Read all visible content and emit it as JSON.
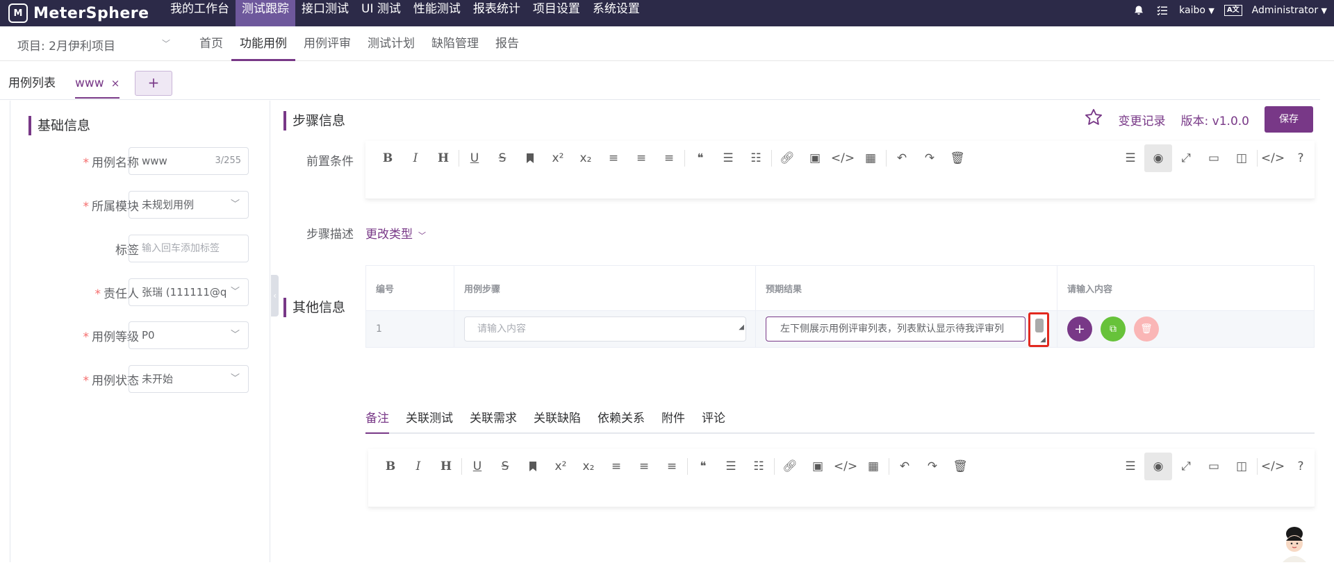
{
  "app": {
    "logo_text": "MeterSphere"
  },
  "topnav": [
    {
      "label": "我的工作台"
    },
    {
      "label": "测试跟踪",
      "active": true
    },
    {
      "label": "接口测试"
    },
    {
      "label": "UI 测试"
    },
    {
      "label": "性能测试"
    },
    {
      "label": "报表统计"
    },
    {
      "label": "项目设置"
    },
    {
      "label": "系统设置"
    }
  ],
  "topright": {
    "workspace": "kaibo",
    "user": "Administrator",
    "lang_badge": "A文"
  },
  "subbar": {
    "project": "项目: 2月伊利项目",
    "items": [
      {
        "label": "首页"
      },
      {
        "label": "功能用例",
        "active": true
      },
      {
        "label": "用例评审"
      },
      {
        "label": "测试计划"
      },
      {
        "label": "缺陷管理"
      },
      {
        "label": "报告"
      }
    ]
  },
  "tabs": {
    "list_label": "用例列表",
    "current_label": "www",
    "close": "×",
    "add": "+"
  },
  "basic": {
    "title": "基础信息",
    "fields": {
      "name": {
        "label": "用例名称",
        "value": "www",
        "counter": "3/255"
      },
      "module": {
        "label": "所属模块",
        "value": "未规划用例"
      },
      "tags": {
        "label": "标签",
        "placeholder": "输入回车添加标签"
      },
      "owner": {
        "label": "责任人",
        "value": "张瑞 (111111@q"
      },
      "level": {
        "label": "用例等级",
        "value": "P0"
      },
      "status": {
        "label": "用例状态",
        "value": "未开始"
      }
    }
  },
  "steps": {
    "title": "步骤信息",
    "history": "变更记录",
    "version": "版本: v1.0.0",
    "save": "保存",
    "precondition_label": "前置条件",
    "desc_label": "步骤描述",
    "change_type": "更改类型",
    "table": {
      "headers": [
        "编号",
        "用例步骤",
        "预期结果",
        "请输入内容"
      ],
      "row": {
        "num": "1",
        "step_placeholder": "请输入内容",
        "expected": "左下侧展示用例评审列表，列表默认显示待我评审列"
      }
    }
  },
  "other": {
    "title": "其他信息",
    "tabs": [
      "备注",
      "关联测试",
      "关联需求",
      "关联缺陷",
      "依赖关系",
      "附件",
      "评论"
    ]
  },
  "colors": {
    "topbar": "#2c2a48",
    "accent": "#783887",
    "green": "#67c23a",
    "danger_light": "#fab6b6",
    "highlight": "#e2291f"
  }
}
